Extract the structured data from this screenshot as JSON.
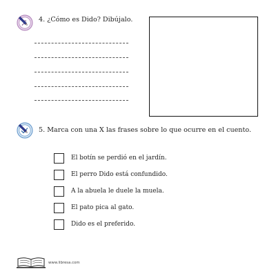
{
  "question4": {
    "icon": "pencil-drawing-icon",
    "text": "4. ¿Cómo es Dido? Dibújalo."
  },
  "question5": {
    "icon": "pencil-check-icon",
    "text": "5. Marca con una X las frases sobre lo que ocurre en el cuento.",
    "options": [
      "El botín se perdió en el jardín.",
      "El perro Dido está confundido.",
      "A la abuela le duele la muela.",
      "El pato pica al gato.",
      "Dido es el preferido."
    ]
  },
  "footer": {
    "logo_icon": "open-book-logo-icon",
    "url": "www.libresa.com"
  },
  "colors": {
    "icon_ring": "#c9a3cf",
    "icon_ring_blue": "#7fb0dc",
    "ink": "#222222"
  }
}
